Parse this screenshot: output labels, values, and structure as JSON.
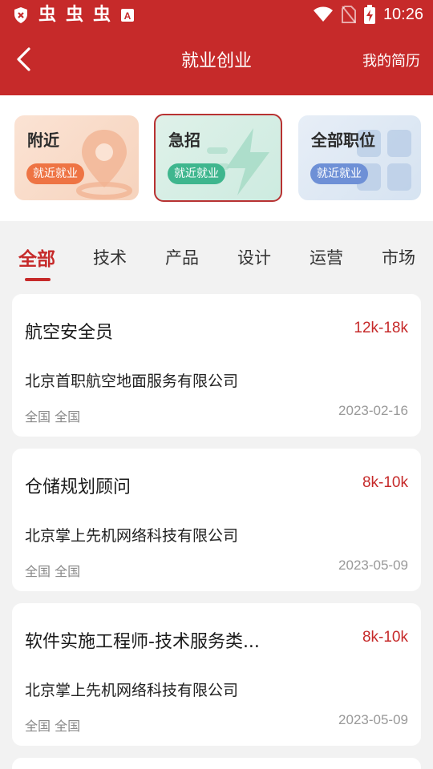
{
  "status_bar": {
    "time": "10:26",
    "left_icons": [
      "shield-icon",
      "bug-icon",
      "bug-icon",
      "bug-icon",
      "a-icon"
    ],
    "right_icons": [
      "wifi-icon",
      "no-sim-icon",
      "battery-charging-icon"
    ]
  },
  "nav": {
    "title": "就业创业",
    "right_label": "我的简历",
    "back_icon": "chevron-left-icon"
  },
  "colors": {
    "brand": "#c62a2a",
    "badge_orange": "#ee7444",
    "badge_green": "#3fb68e",
    "badge_blue": "#6e90d6"
  },
  "cards": [
    {
      "title": "附近",
      "badge": "就近就业",
      "icon": "location-pin-icon"
    },
    {
      "title": "急招",
      "badge": "就近就业",
      "icon": "lightning-icon"
    },
    {
      "title": "全部职位",
      "badge": "就近就业",
      "icon": "grid-icon"
    }
  ],
  "tabs": [
    {
      "label": "全部",
      "active": true
    },
    {
      "label": "技术"
    },
    {
      "label": "产品"
    },
    {
      "label": "设计"
    },
    {
      "label": "运营"
    },
    {
      "label": "市场"
    }
  ],
  "jobs": [
    {
      "title": "航空安全员",
      "salary": "12k-18k",
      "company": "北京首职航空地面服务有限公司",
      "location": "全国 全国",
      "date": "2023-02-16"
    },
    {
      "title": "仓储规划顾问",
      "salary": "8k-10k",
      "company": "北京掌上先机网络科技有限公司",
      "location": "全国 全国",
      "date": "2023-05-09"
    },
    {
      "title": "软件实施工程师-技术服务类...",
      "salary": "8k-10k",
      "company": "北京掌上先机网络科技有限公司",
      "location": "全国 全国",
      "date": "2023-05-09"
    }
  ]
}
